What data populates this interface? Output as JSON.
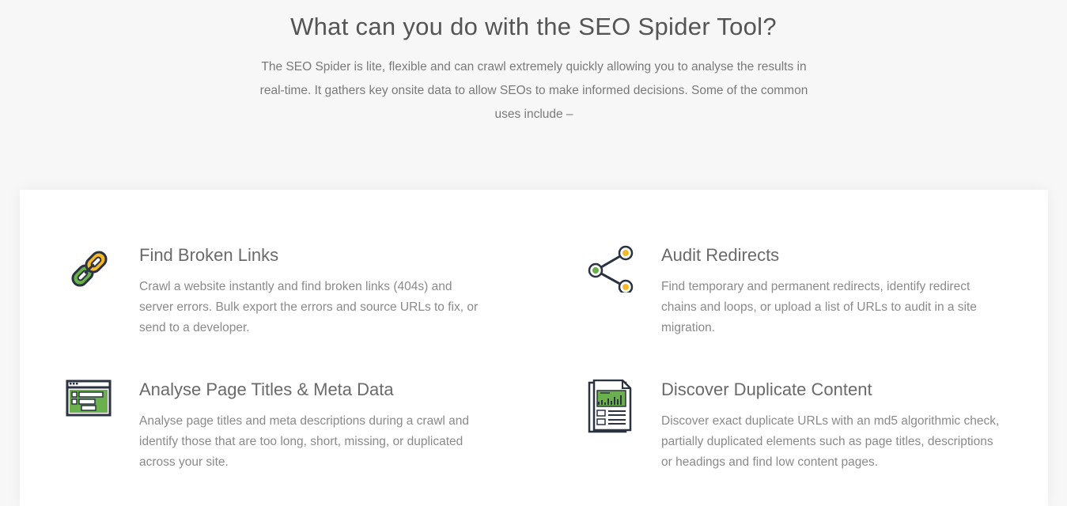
{
  "intro": {
    "heading": "What can you do with the SEO Spider Tool?",
    "description": "The SEO Spider is lite, flexible and can crawl extremely quickly allowing you to analyse the results in real-time. It gathers key onsite data to allow SEOs to make informed decisions. Some of the common uses include –"
  },
  "features": [
    {
      "icon": "broken-link-icon",
      "title": "Find Broken Links",
      "description": "Crawl a website instantly and find broken links (404s) and server errors. Bulk export the errors and source URLs to fix, or send to a developer."
    },
    {
      "icon": "redirect-icon",
      "title": "Audit Redirects",
      "description": "Find temporary and permanent redirects, identify redirect chains and loops, or upload a list of URLs to audit in a site migration."
    },
    {
      "icon": "page-titles-icon",
      "title": "Analyse Page Titles & Meta Data",
      "description": "Analyse page titles and meta descriptions during a crawl and identify those that are too long, short, missing, or duplicated across your site."
    },
    {
      "icon": "duplicate-content-icon",
      "title": "Discover Duplicate Content",
      "description": "Discover exact duplicate URLs with an md5 algorithmic check, partially duplicated elements such as page titles, descriptions or headings and find low content pages."
    }
  ],
  "colors": {
    "green": "#6ab04c",
    "orange": "#f5b829",
    "dark": "#2c3340"
  }
}
